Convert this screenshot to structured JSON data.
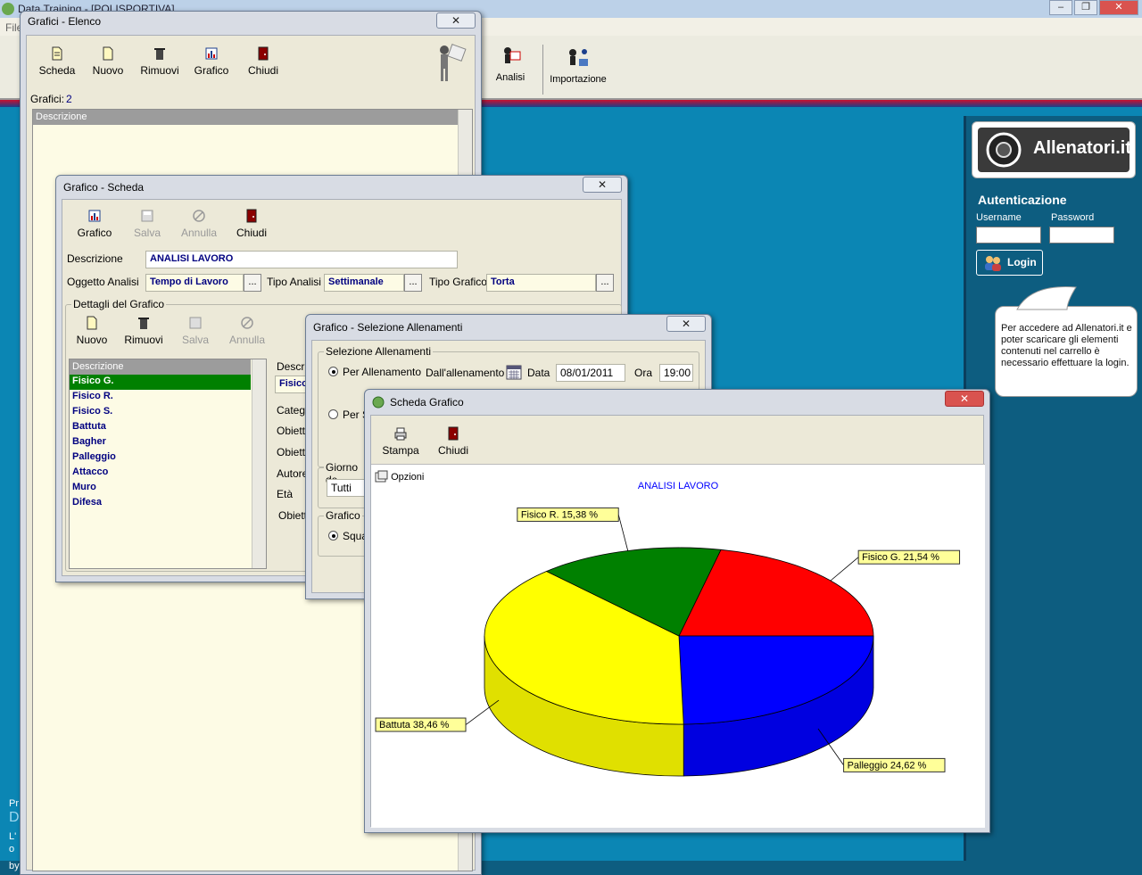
{
  "app": {
    "title": "Data Training - [POLISPORTIVA]",
    "menu_first": "File",
    "toolbar_analisi": "Analisi",
    "toolbar_importazione": "Importazione",
    "left_text": [
      "Pr",
      "D",
      "L'",
      "o",
      "by"
    ]
  },
  "right_panel": {
    "logo_text": "Allenatori.it",
    "auth_title": "Autenticazione",
    "username_label": "Username",
    "password_label": "Password",
    "login_label": "Login",
    "bubble_text": "Per accedere ad Allenatori.it e poter scaricare gli elementi contenuti nel carrello è necessario effettuare la login."
  },
  "elenco": {
    "title": "Grafici - Elenco",
    "toolbar": [
      "Scheda",
      "Nuovo",
      "Rimuovi",
      "Grafico",
      "Chiudi"
    ],
    "count_label": "Grafici:",
    "count_value": "2",
    "column": "Descrizione"
  },
  "scheda": {
    "title": "Grafico - Scheda",
    "toolbar": {
      "grafico": "Grafico",
      "salva": "Salva",
      "annulla": "Annulla",
      "chiudi": "Chiudi"
    },
    "descrizione_label": "Descrizione",
    "descrizione_value": "ANALISI LAVORO",
    "oggetto_label": "Oggetto Analisi",
    "oggetto_value": "Tempo di Lavoro",
    "tipo_analisi_label": "Tipo Analisi",
    "tipo_analisi_value": "Settimanale",
    "tipo_grafico_label": "Tipo Grafico",
    "tipo_grafico_value": "Torta",
    "dettagli_label": "Dettagli del Grafico",
    "dettagli_toolbar": {
      "nuovo": "Nuovo",
      "rimuovi": "Rimuovi",
      "salva": "Salva",
      "annulla": "Annulla"
    },
    "list_header": "Descrizione",
    "list_items": [
      "Fisico G.",
      "Fisico R.",
      "Fisico S.",
      "Battuta",
      "Bagher",
      "Palleggio",
      "Attacco",
      "Muro",
      "Difesa"
    ],
    "right_labels": [
      "Descri",
      "Catego",
      "Obietti",
      "Obietti",
      "Autore",
      "Età",
      "Obietti"
    ],
    "right_field_value": "Fisico"
  },
  "selezione": {
    "title": "Grafico - Selezione Allenamenti",
    "group_label": "Selezione Allenamenti",
    "radio1": "Per Allenamento",
    "dall_label": "Dall'allenamento",
    "data_label": "Data",
    "data_value": "08/01/2011",
    "ora_label": "Ora",
    "ora_value": "19:00",
    "radio2": "Per S",
    "giorno_label": "Giorno de",
    "giorno_value": "Tutti",
    "grafico_label": "Grafico",
    "grafico_radio": "Squa"
  },
  "grafico_window": {
    "title": "Scheda Grafico",
    "toolbar": {
      "stampa": "Stampa",
      "chiudi": "Chiudi"
    },
    "opzioni": "Opzioni"
  },
  "chart_data": {
    "type": "pie",
    "title": "ANALISI LAVORO",
    "slices": [
      {
        "name": "Fisico G.",
        "label": "Fisico G. 21,54 %",
        "value": 21.54,
        "color": "#ff0000"
      },
      {
        "name": "Palleggio",
        "label": "Palleggio 24,62 %",
        "value": 24.62,
        "color": "#0000ff"
      },
      {
        "name": "Battuta",
        "label": "Battuta 38,46 %",
        "value": 38.46,
        "color": "#ffff00"
      },
      {
        "name": "Fisico R.",
        "label": "Fisico R. 15,38 %",
        "value": 15.38,
        "color": "#008000"
      }
    ]
  }
}
